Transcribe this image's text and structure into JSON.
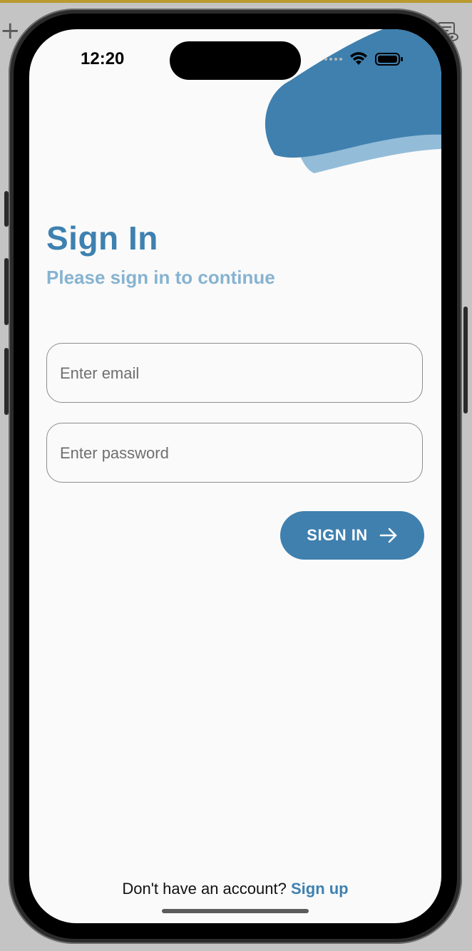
{
  "status_bar": {
    "time": "12:20"
  },
  "header": {
    "title": "Sign In",
    "subtitle": "Please sign in to continue"
  },
  "form": {
    "email": {
      "placeholder": "Enter email",
      "value": ""
    },
    "password": {
      "placeholder": "Enter password",
      "value": ""
    },
    "submit_label": "SIGN IN"
  },
  "footer": {
    "prompt": "Don't have an account?",
    "link": "Sign up"
  },
  "colors": {
    "primary": "#3e81b0",
    "primary_light": "#86b3d1",
    "background": "#fafafa"
  },
  "icons": {
    "submit": "arrow-right-icon",
    "status": [
      "signal-icon",
      "wifi-icon",
      "battery-icon"
    ],
    "host": [
      "plus-icon",
      "inspector-eye-icon"
    ]
  }
}
